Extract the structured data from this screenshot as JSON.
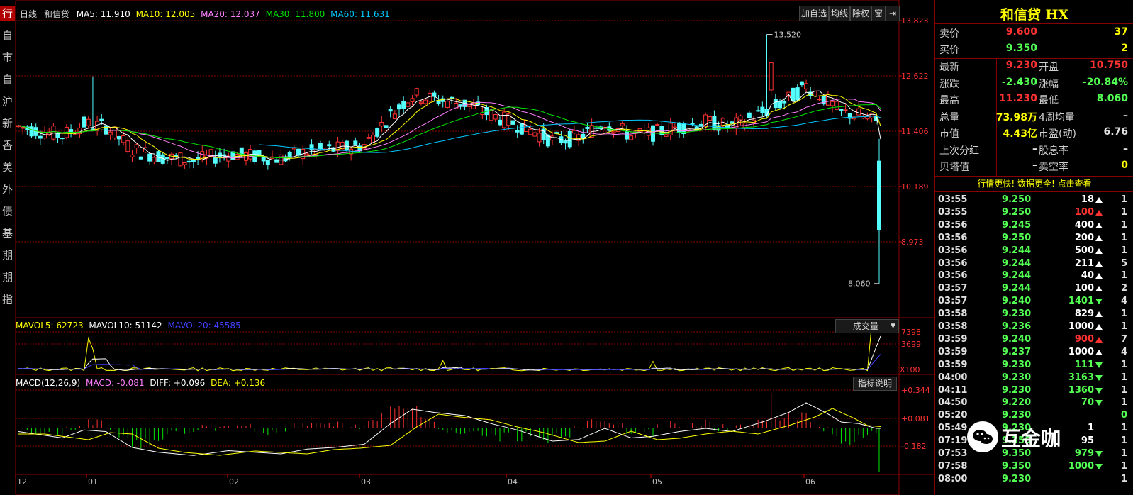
{
  "colors": {
    "up": "#ff3232",
    "down": "#54ffff",
    "ma5": "#ffffff",
    "ma10": "#ffff00",
    "ma20": "#ff80ff",
    "ma30": "#00e600",
    "ma60": "#00c8ff",
    "grid": "#8b0000",
    "yellow": "#ffff00",
    "green": "#00e600"
  },
  "left_nav": [
    "行",
    "自",
    "市",
    "自",
    "沪",
    "新",
    "香",
    "美",
    "外",
    "债",
    "基",
    "期",
    "期",
    "指"
  ],
  "chart_header": {
    "period": "日线",
    "name": "和信贷",
    "ma5": "MA5: 11.910",
    "ma10": "MA10: 12.005",
    "ma20": "MA20: 12.037",
    "ma30": "MA30: 11.800",
    "ma60": "MA60: 11.631"
  },
  "toolbar": {
    "add": "加自选",
    "avg": "均线",
    "adj": "除权",
    "win": "窗",
    "next": "⇥"
  },
  "price_axis": [
    "13.823",
    "12.622",
    "11.406",
    "10.189",
    "8.973"
  ],
  "annotations": {
    "high": "13.520",
    "low": "8.060"
  },
  "volume": {
    "mavol5": "MAVOL5: 62723",
    "mavol10": "MAVOL10: 51142",
    "mavol20": "MAVOL20: 45585",
    "selector": "成交量",
    "axis": [
      "7398",
      "3699"
    ],
    "unit": "X100"
  },
  "macd": {
    "title": "MACD(12,26,9)",
    "macd": "MACD: -0.081",
    "diff": "DIFF: +0.096",
    "dea": "DEA: +0.136",
    "help": "指标说明",
    "axis": [
      "+0.344",
      "+0.081",
      "-0.182"
    ]
  },
  "months": [
    "12",
    "01",
    "02",
    "03",
    "04",
    "05",
    "06"
  ],
  "panel": {
    "title": "和信贷 HX",
    "sell_label": "卖价",
    "sell_price": "9.600",
    "sell_vol": "37",
    "buy_label": "买价",
    "buy_price": "9.350",
    "buy_vol": "2",
    "rows": [
      {
        "l1": "最新",
        "v1": "9.230",
        "l2": "开盘",
        "v2": "10.750",
        "c1": "up",
        "c2": "up"
      },
      {
        "l1": "涨跌",
        "v1": "-2.430",
        "l2": "涨幅",
        "v2": "-20.84%",
        "c1": "down",
        "c2": "down"
      },
      {
        "l1": "最高",
        "v1": "11.230",
        "l2": "最低",
        "v2": "8.060",
        "c1": "up",
        "c2": "down"
      },
      {
        "l1": "总量",
        "v1": "73.98万",
        "l2": "4周均量",
        "v2": "–",
        "c1": "yellow",
        "c2": "white"
      },
      {
        "l1": "市值",
        "v1": "4.43亿",
        "l2": "市盈(动)",
        "v2": "6.76",
        "c1": "yellow",
        "c2": "white"
      },
      {
        "l1": "上次分红",
        "v1": "–",
        "l2": "股息率",
        "v2": "–",
        "c1": "white",
        "c2": "white"
      },
      {
        "l1": "贝塔值",
        "v1": "–",
        "l2": "卖空率",
        "v2": "0",
        "c1": "white",
        "c2": "yellow"
      }
    ],
    "promo": "行情更快! 数据更全! 点击查看",
    "trades": [
      {
        "t": "03:55",
        "p": "9.250",
        "v": "18",
        "d": "w",
        "n": "1"
      },
      {
        "t": "03:55",
        "p": "9.250",
        "v": "100",
        "d": "r",
        "n": "1"
      },
      {
        "t": "03:56",
        "p": "9.245",
        "v": "400",
        "d": "w",
        "n": "1"
      },
      {
        "t": "03:56",
        "p": "9.250",
        "v": "200",
        "d": "w",
        "n": "1"
      },
      {
        "t": "03:56",
        "p": "9.244",
        "v": "500",
        "d": "w",
        "n": "1"
      },
      {
        "t": "03:56",
        "p": "9.244",
        "v": "211",
        "d": "w",
        "n": "5"
      },
      {
        "t": "03:56",
        "p": "9.244",
        "v": "40",
        "d": "w",
        "n": "1"
      },
      {
        "t": "03:57",
        "p": "9.244",
        "v": "100",
        "d": "w",
        "n": "2"
      },
      {
        "t": "03:57",
        "p": "9.240",
        "v": "1401",
        "d": "g",
        "n": "4"
      },
      {
        "t": "03:58",
        "p": "9.230",
        "v": "829",
        "d": "w",
        "n": "1"
      },
      {
        "t": "03:58",
        "p": "9.236",
        "v": "1000",
        "d": "w",
        "n": "1"
      },
      {
        "t": "03:59",
        "p": "9.240",
        "v": "900",
        "d": "r",
        "n": "7"
      },
      {
        "t": "03:59",
        "p": "9.237",
        "v": "1000",
        "d": "w",
        "n": "4"
      },
      {
        "t": "03:59",
        "p": "9.230",
        "v": "111",
        "d": "g",
        "n": "1"
      },
      {
        "t": "04:00",
        "p": "9.230",
        "v": "3163",
        "d": "g",
        "n": "1"
      },
      {
        "t": "04:11",
        "p": "9.230",
        "v": "1360",
        "d": "g",
        "n": "1"
      },
      {
        "t": "04:50",
        "p": "9.220",
        "v": "70",
        "d": "g",
        "n": "1"
      },
      {
        "t": "05:20",
        "p": "9.230",
        "v": "",
        "d": "",
        "n": "0"
      },
      {
        "t": "05:49",
        "p": "9.230",
        "v": "1",
        "d": "",
        "n": "1"
      },
      {
        "t": "07:19",
        "p": "9.350",
        "v": "95",
        "d": "",
        "n": "1"
      },
      {
        "t": "07:53",
        "p": "9.350",
        "v": "979",
        "d": "g",
        "n": "1"
      },
      {
        "t": "07:58",
        "p": "9.350",
        "v": "1000",
        "d": "g",
        "n": "1"
      },
      {
        "t": "08:00",
        "p": "9.230",
        "v": "",
        "d": "",
        "n": "1"
      }
    ]
  },
  "watermark": "互金咖"
}
